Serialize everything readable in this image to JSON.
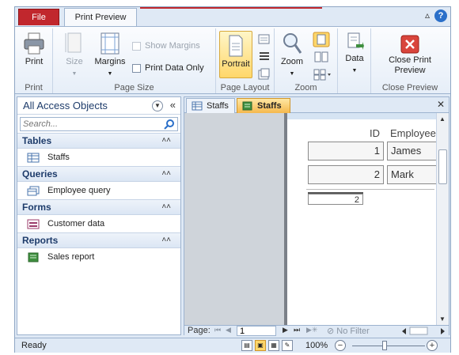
{
  "ribbon_tabs": {
    "file": "File",
    "print_preview": "Print Preview"
  },
  "ribbon": {
    "print_group": {
      "print_label": "Print",
      "group_label": "Print"
    },
    "page_size_group": {
      "size_label": "Size",
      "margins_label": "Margins",
      "show_margins_label": "Show Margins",
      "print_data_only_label": "Print Data Only",
      "group_label": "Page Size"
    },
    "page_layout_group": {
      "portrait_label": "Portrait",
      "group_label": "Page Layout"
    },
    "zoom_group": {
      "zoom_label": "Zoom",
      "group_label": "Zoom"
    },
    "data_group": {
      "data_label": "Data"
    },
    "close_group": {
      "close_label_line1": "Close Print",
      "close_label_line2": "Preview",
      "group_label": "Close Preview"
    }
  },
  "nav_pane": {
    "title": "All Access Objects",
    "search_placeholder": "Search...",
    "sections": [
      {
        "label": "Tables",
        "items": [
          {
            "label": "Staffs",
            "icon": "table-icon"
          }
        ]
      },
      {
        "label": "Queries",
        "items": [
          {
            "label": "Employee query",
            "icon": "query-icon"
          }
        ]
      },
      {
        "label": "Forms",
        "items": [
          {
            "label": "Customer data",
            "icon": "form-icon"
          }
        ]
      },
      {
        "label": "Reports",
        "items": [
          {
            "label": "Sales report",
            "icon": "report-icon"
          }
        ]
      }
    ]
  },
  "doc_tabs": [
    {
      "label": "Staffs",
      "icon": "table-icon",
      "active": false
    },
    {
      "label": "Staffs",
      "icon": "report-icon",
      "active": true
    }
  ],
  "preview": {
    "headers": {
      "id": "ID",
      "employee": "Employee"
    },
    "rows": [
      {
        "id": "1",
        "name": "James"
      },
      {
        "id": "2",
        "name": "Mark"
      }
    ],
    "partial_row_id": "2"
  },
  "record_nav": {
    "page_label": "Page:",
    "page_value": "1",
    "filter_label": "No Filter"
  },
  "status_bar": {
    "ready": "Ready",
    "zoom_percent": "100%",
    "zoom_level": 0.45
  },
  "colors": {
    "file_tab": "#c1272d",
    "active_tab": "#f5b84d",
    "accent": "#2a6fc9"
  }
}
